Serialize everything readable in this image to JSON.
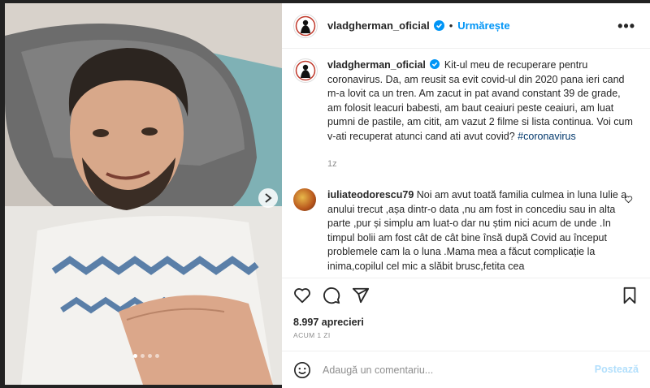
{
  "header": {
    "username": "vladgherman_oficial",
    "separator": "•",
    "follow_label": "Urmărește",
    "more_label": "•••"
  },
  "caption": {
    "username": "vladgherman_oficial",
    "text": "Kit-ul meu de recuperare pentru coronavirus. Da, am reusit sa evit covid-ul din 2020 pana ieri cand m-a lovit ca un tren. Am zacut in pat avand constant 39 de grade, am folosit leacuri babesti, am baut ceaiuri peste ceaiuri, am luat pumni de pastile, am citit, am vazut 2 filme si lista continua. Voi cum v-ati recuperat atunci cand ati avut covid?",
    "hashtag": "#coronavirus",
    "time": "1z"
  },
  "comment": {
    "username": "iuliateodorescu79",
    "text": "Noi am avut toată familia culmea in luna Iulie a anului trecut ,așa dintr-o data ,nu am fost in concediu sau in alta parte ,pur și simplu am luat-o dar nu știm nici acum de unde .In timpul bolii am fost cât de cât bine însă după Covid au început problemele cam la o luna .Mama mea a făcut complicație la inima,copilul cel mic a slăbit brusc,fetita cea"
  },
  "stats": {
    "likes": "8.997 aprecieri",
    "ago": "ACUM 1 ZI"
  },
  "add_comment": {
    "placeholder": "Adaugă un comentariu...",
    "post_label": "Postează"
  },
  "carousel": {
    "count": 4,
    "active_index": 0
  },
  "colors": {
    "accent": "#0095f6",
    "text": "#262626",
    "muted": "#8e8e8e",
    "backdrop": "#222222"
  },
  "icons": [
    "verified-badge-icon",
    "more-options-icon",
    "heart-icon",
    "comment-icon",
    "share-icon",
    "bookmark-icon",
    "emoji-icon",
    "chevron-right-icon"
  ]
}
